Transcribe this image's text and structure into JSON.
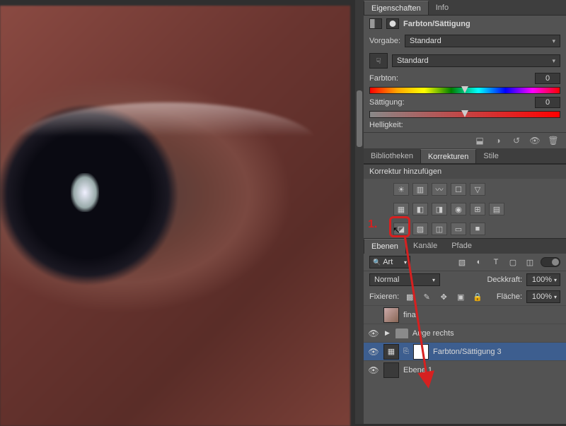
{
  "panels": {
    "eigenschaften": {
      "tab_props": "Eigenschaften",
      "tab_info": "Info"
    },
    "adjustment_title": "Farbton/Sättigung",
    "preset": {
      "label": "Vorgabe:",
      "value": "Standard"
    },
    "colorrange": {
      "value": "Standard"
    },
    "hue": {
      "label": "Farbton:",
      "value": "0"
    },
    "sat": {
      "label": "Sättigung:",
      "value": "0"
    },
    "light": {
      "label": "Helligkeit:"
    },
    "korrekturen": {
      "tab_lib": "Bibliotheken",
      "tab_corr": "Korrekturen",
      "tab_style": "Stile",
      "heading": "Korrektur hinzufügen"
    },
    "layers": {
      "tab_layers": "Ebenen",
      "tab_channels": "Kanäle",
      "tab_paths": "Pfade",
      "filter": "Art",
      "blend_mode": "Normal",
      "opacity_label": "Deckkraft:",
      "opacity_value": "100%",
      "lock_label": "Fixieren:",
      "fill_label": "Fläche:",
      "fill_value": "100%",
      "layer_final": "final",
      "group_aug": "Auge rechts",
      "layer_hue": "Farbton/Sättigung 3",
      "layer_bg": "Ebene 1"
    }
  },
  "red_callout": "1.",
  "adj_icons": {
    "r1": [
      "brightness",
      "levels",
      "curves",
      "exposure",
      "vibrance"
    ],
    "r2": [
      "hue-sat",
      "color-balance",
      "bw",
      "photo-filter",
      "channel-mixer",
      "lookup"
    ],
    "r3": [
      "invert",
      "posterize",
      "threshold",
      "gradient-map",
      "selective-color"
    ]
  },
  "footer_icons": [
    "clip-icon",
    "reset-icon",
    "visibility-icon",
    "trash-icon"
  ]
}
